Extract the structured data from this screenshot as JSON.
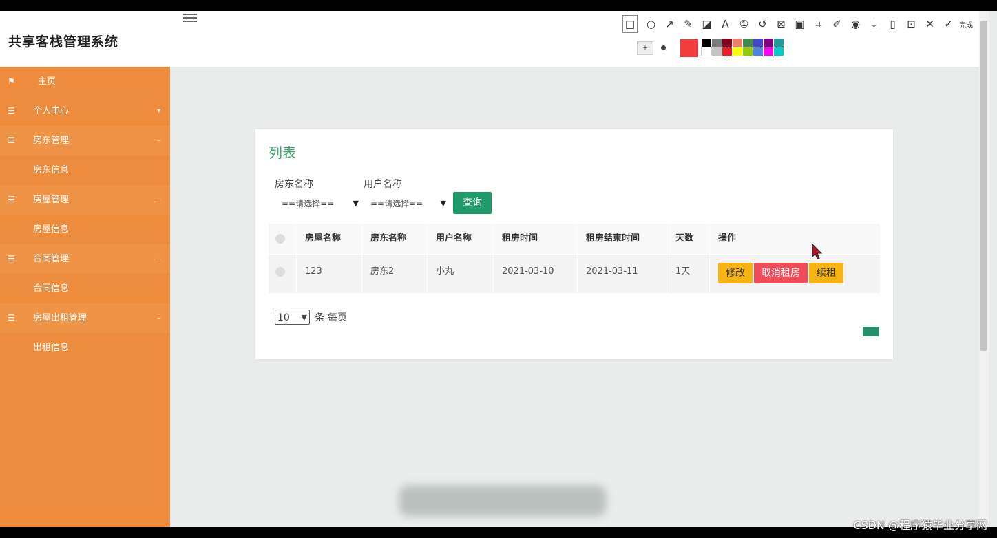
{
  "app": {
    "title": "共享客栈管理系统"
  },
  "sidebar": {
    "items": [
      {
        "label": "主页",
        "icon": "flag-icon",
        "type": "home"
      },
      {
        "label": "个人中心",
        "icon": "list-icon",
        "type": "parent"
      },
      {
        "label": "房东管理",
        "icon": "list-icon",
        "type": "parent"
      },
      {
        "label": "房东信息",
        "type": "child"
      },
      {
        "label": "房屋管理",
        "icon": "list-icon",
        "type": "parent"
      },
      {
        "label": "房屋信息",
        "type": "child"
      },
      {
        "label": "合同管理",
        "icon": "list-icon",
        "type": "parent"
      },
      {
        "label": "合同信息",
        "type": "child"
      },
      {
        "label": "房屋出租管理",
        "icon": "list-icon",
        "type": "parent"
      },
      {
        "label": "出租信息",
        "type": "child"
      }
    ]
  },
  "main": {
    "card_title": "列表",
    "filters": {
      "landlord_label": "房东名称",
      "landlord_value": "==请选择==",
      "user_label": "用户名称",
      "user_value": "==请选择==",
      "query_button": "查询"
    },
    "table": {
      "headers": [
        "房屋名称",
        "房东名称",
        "用户名称",
        "租房时间",
        "租房结束时间",
        "天数",
        "操作"
      ],
      "rows": [
        {
          "house_name": "123",
          "landlord": "房东2",
          "user": "小丸",
          "start": "2021-03-10",
          "end": "2021-03-11",
          "days": "1天",
          "actions": {
            "edit": "修改",
            "cancel": "取消租房",
            "renew": "续租"
          }
        }
      ]
    },
    "pager": {
      "page_size": "10",
      "suffix": "条 每页"
    }
  },
  "annotation_toolbar": {
    "tools": [
      "rectangle-icon",
      "ellipse-icon",
      "arrow-icon",
      "pencil-icon",
      "mosaic-icon",
      "text-icon",
      "number-icon",
      "undo-icon",
      "delete-icon",
      "pin-icon",
      "ocr-icon",
      "translate-icon",
      "record-icon",
      "download-icon",
      "copy-icon",
      "save-icon",
      "close-icon",
      "check-icon"
    ],
    "done_label": "完成",
    "current_color": "#f23b3b",
    "palette": [
      "#000000",
      "#7f7f7f",
      "#880015",
      "#ed7d6d",
      "#3d8a4c",
      "#3f48cc",
      "#800080",
      "#1f9a9a",
      "#ffffff",
      "#c3c3c3",
      "#ed1c24",
      "#ffff00",
      "#8fce00",
      "#4a86e8",
      "#ff00ff",
      "#00cccc"
    ]
  },
  "watermark": "CSDN @程序猿毕业分享网",
  "colors": {
    "sidebar": "#ec8c3c",
    "accent_green": "#1f9a6a",
    "title_green": "#3aa76d",
    "btn_yellow": "#f6b313",
    "btn_red": "#ef4d5a"
  }
}
